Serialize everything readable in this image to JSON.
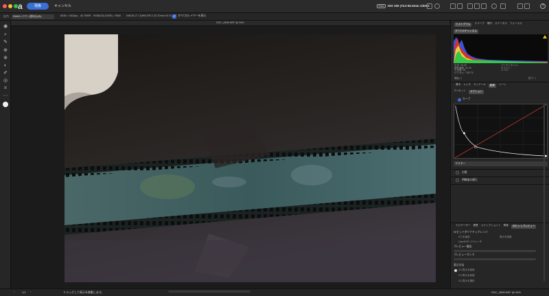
{
  "titlebar": {
    "develop_label": "現像",
    "cancel_label": "キャンセル",
    "raw_badge": "RAW",
    "exif": "ISO 100 ƒ/4.0 82.0mm 1/320s",
    "help_label": "?"
  },
  "contextbar": {
    "output_label": "出力",
    "output_value": "RAWレイヤー(埋め込み)",
    "file_info": "6036 × 4024px、40.75MP、RGBA/32 (HDR) - RAW",
    "lens_info": "NIKON Z 7 (NIKKOR Z 24-70mm f/4 S)",
    "show_layers_label": "すべてのレイヤーを表示",
    "show_layers_checked": "✓"
  },
  "document": {
    "title": "DSC_4598.NEF @ 34%"
  },
  "panel": {
    "top_tabs": [
      "ヒストグラム",
      "スコープ",
      "場所",
      "ステータス",
      "フォーカス"
    ],
    "histogram_channel": "すべてのチャンネル",
    "stats_left": [
      "平均: 33.09",
      "標準偏差: 31.69",
      "中央値: 28",
      "ピクセル: 738775"
    ],
    "stats_right": [
      "パーセンタイル:",
      "カウント:",
      "レベル:"
    ],
    "range_from_label": "開始: 0",
    "range_to_label": "終了: 1",
    "section_tabs": [
      "基本",
      "レンズ",
      "ディテール",
      "曲線",
      "トーン"
    ],
    "preset_tabs": [
      "プリセット",
      "オプション"
    ],
    "curve_label": "カーブ",
    "master_label": "マスター",
    "rows": [
      "白黒",
      "明瞭度の補正"
    ],
    "bottom_tabs": [
      "ナビゲーター",
      "履歴",
      "スナップショット",
      "情報",
      "32ビットプレビュー"
    ],
    "preview_heading": "32ビットダイナミックレンジ",
    "preview_options": [
      "ICCを使用",
      "表示を制限",
      "OpenEXR パラメータ"
    ],
    "slider_labels": [
      "プレビュー露出",
      "プレビューガンマ"
    ],
    "display_heading": "表示方法",
    "display_options": [
      "ICC表示を使用",
      "ICC表示を無視",
      "ICC表示を選択"
    ]
  },
  "statusbar": {
    "page": "1/1",
    "hint": "ドラッグして表示を移動します。",
    "filename": "DSC_4598.NEF @ 34%"
  },
  "colors": {
    "accent": "#3a6fd8",
    "panel_bg": "#262626",
    "canvas_bg": "#1b1b1b",
    "curve_red": "#c23b3b"
  }
}
